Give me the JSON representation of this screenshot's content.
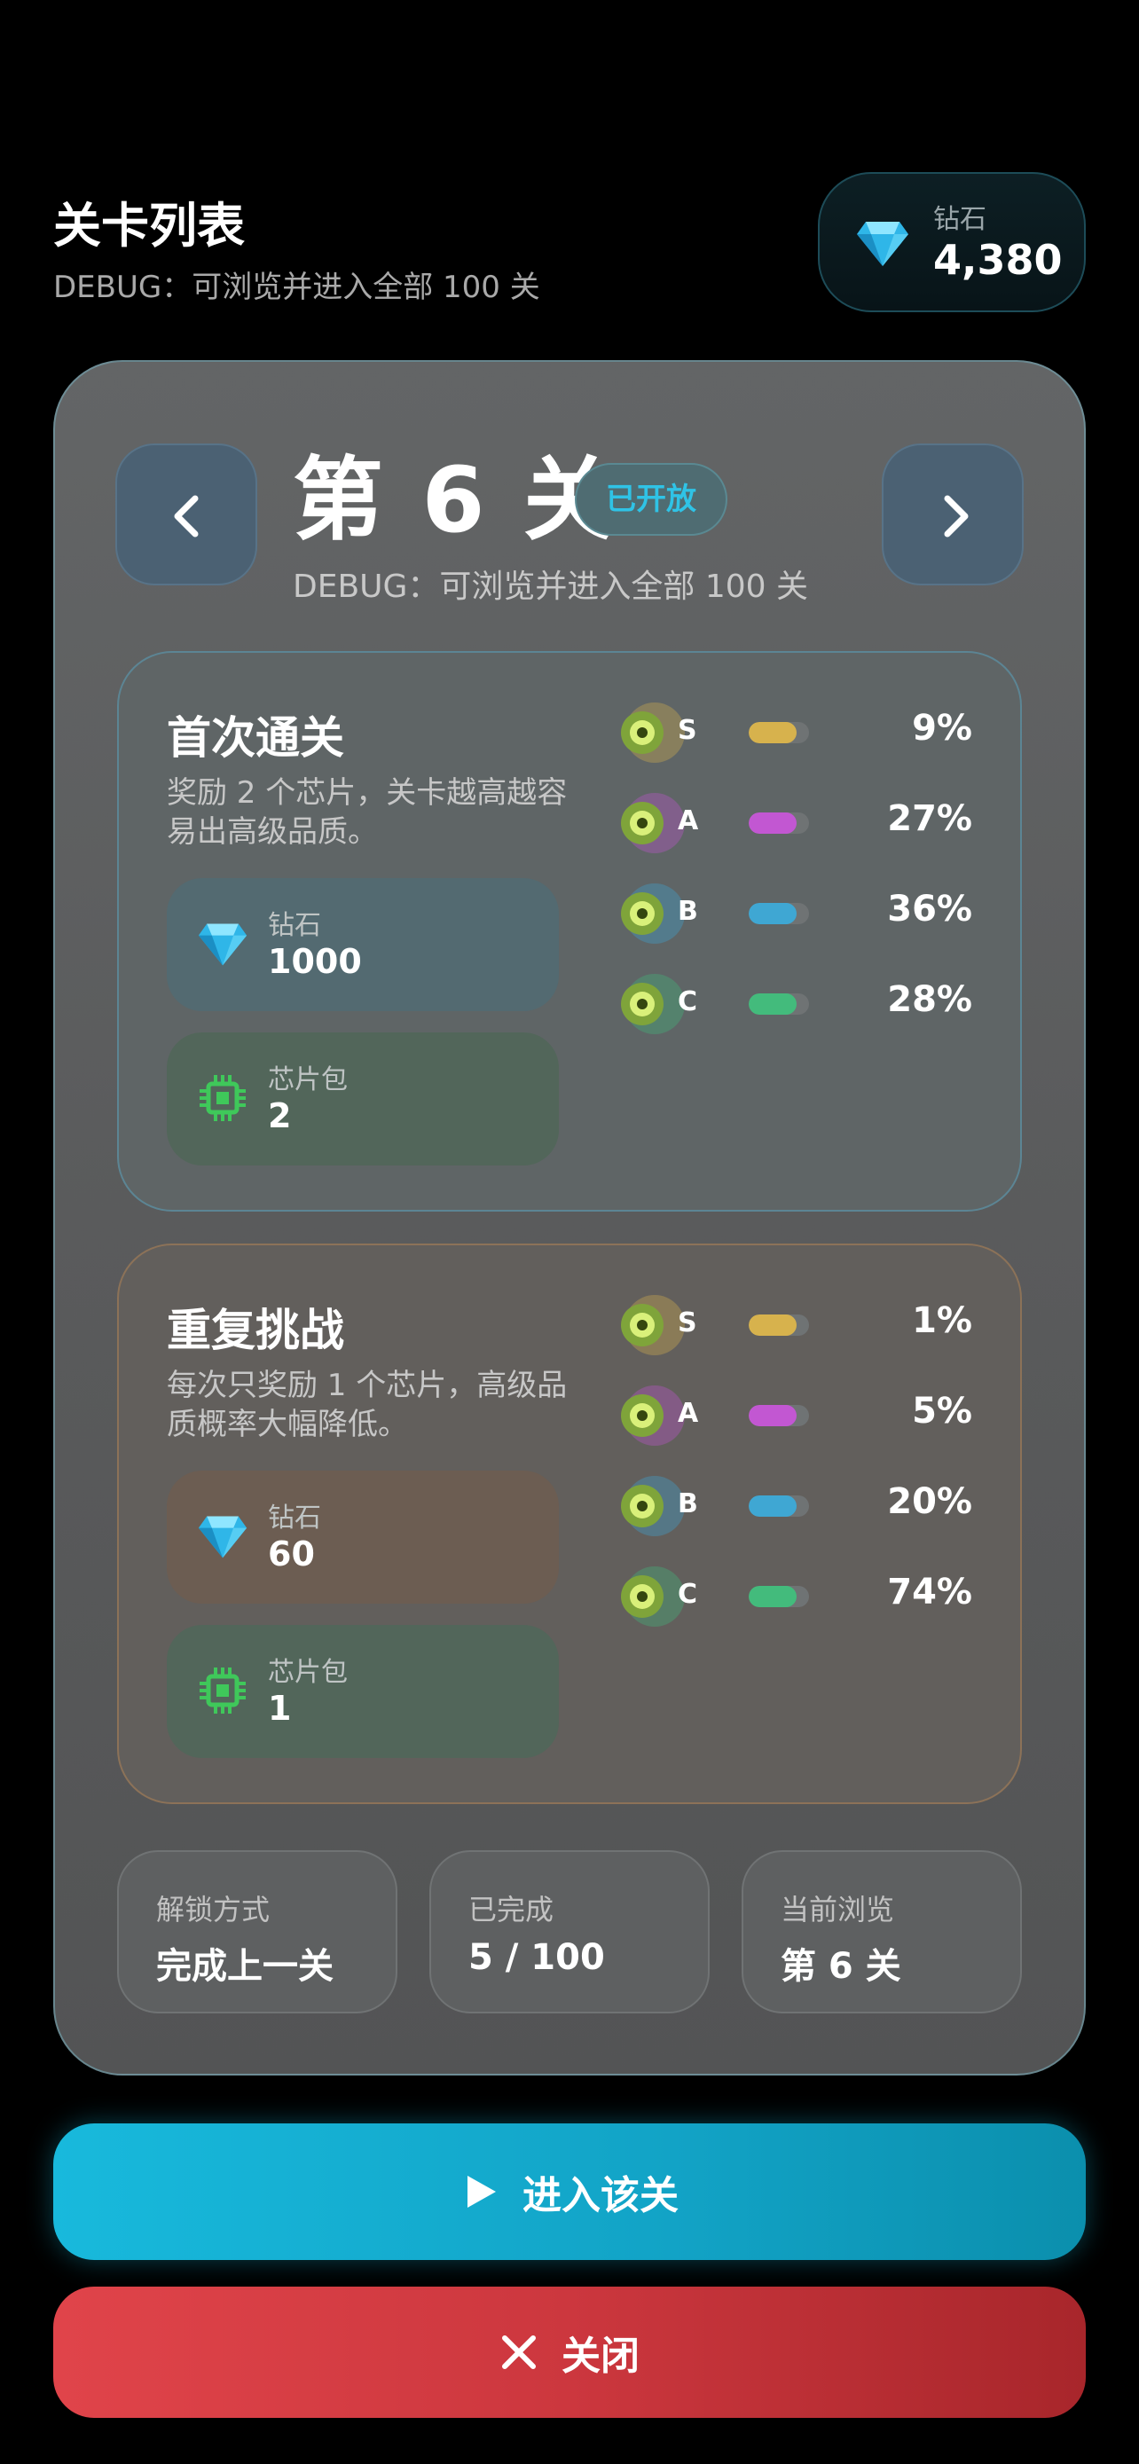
{
  "header": {
    "title": "关卡列表",
    "subtitle": "DEBUG：可浏览并进入全部 100 关",
    "diamond_label": "钻石",
    "diamond_value": "4,380"
  },
  "level": {
    "title": "第 6 关",
    "status_badge": "已开放",
    "subtitle": "DEBUG：可浏览并进入全部 100 关"
  },
  "first_clear": {
    "title": "首次通关",
    "description": "奖励 2 个芯片，关卡越高越容易出高级品质。",
    "rewards": [
      {
        "label": "钻石",
        "value": "1000",
        "icon": "diamond-icon"
      },
      {
        "label": "芯片包",
        "value": "2",
        "icon": "chip-icon"
      }
    ],
    "grades": [
      {
        "grade": "S",
        "percent": "9%",
        "fill": 0.8,
        "color": "#d7b24d"
      },
      {
        "grade": "A",
        "percent": "27%",
        "fill": 0.8,
        "color": "#c257d2"
      },
      {
        "grade": "B",
        "percent": "36%",
        "fill": 0.8,
        "color": "#3fa7d3"
      },
      {
        "grade": "C",
        "percent": "28%",
        "fill": 0.8,
        "color": "#43bb7c"
      }
    ]
  },
  "repeat": {
    "title": "重复挑战",
    "description": "每次只奖励 1 个芯片，高级品质概率大幅降低。",
    "rewards": [
      {
        "label": "钻石",
        "value": "60",
        "icon": "diamond-icon"
      },
      {
        "label": "芯片包",
        "value": "1",
        "icon": "chip-icon"
      }
    ],
    "grades": [
      {
        "grade": "S",
        "percent": "1%",
        "fill": 0.8,
        "color": "#d7b24d"
      },
      {
        "grade": "A",
        "percent": "5%",
        "fill": 0.8,
        "color": "#c257d2"
      },
      {
        "grade": "B",
        "percent": "20%",
        "fill": 0.8,
        "color": "#3fa7d3"
      },
      {
        "grade": "C",
        "percent": "74%",
        "fill": 0.8,
        "color": "#43bb7c"
      }
    ]
  },
  "stats": [
    {
      "label": "解锁方式",
      "value": "完成上一关"
    },
    {
      "label": "已完成",
      "value": "5 / 100"
    },
    {
      "label": "当前浏览",
      "value": "第 6 关"
    }
  ],
  "buttons": {
    "enter_label": "进入该关",
    "close_label": "关闭"
  },
  "colors": {
    "accent": "#18b9dc",
    "danger": "#e0444a",
    "diamond": "#39c6ef",
    "chip": "#3fc85a"
  }
}
